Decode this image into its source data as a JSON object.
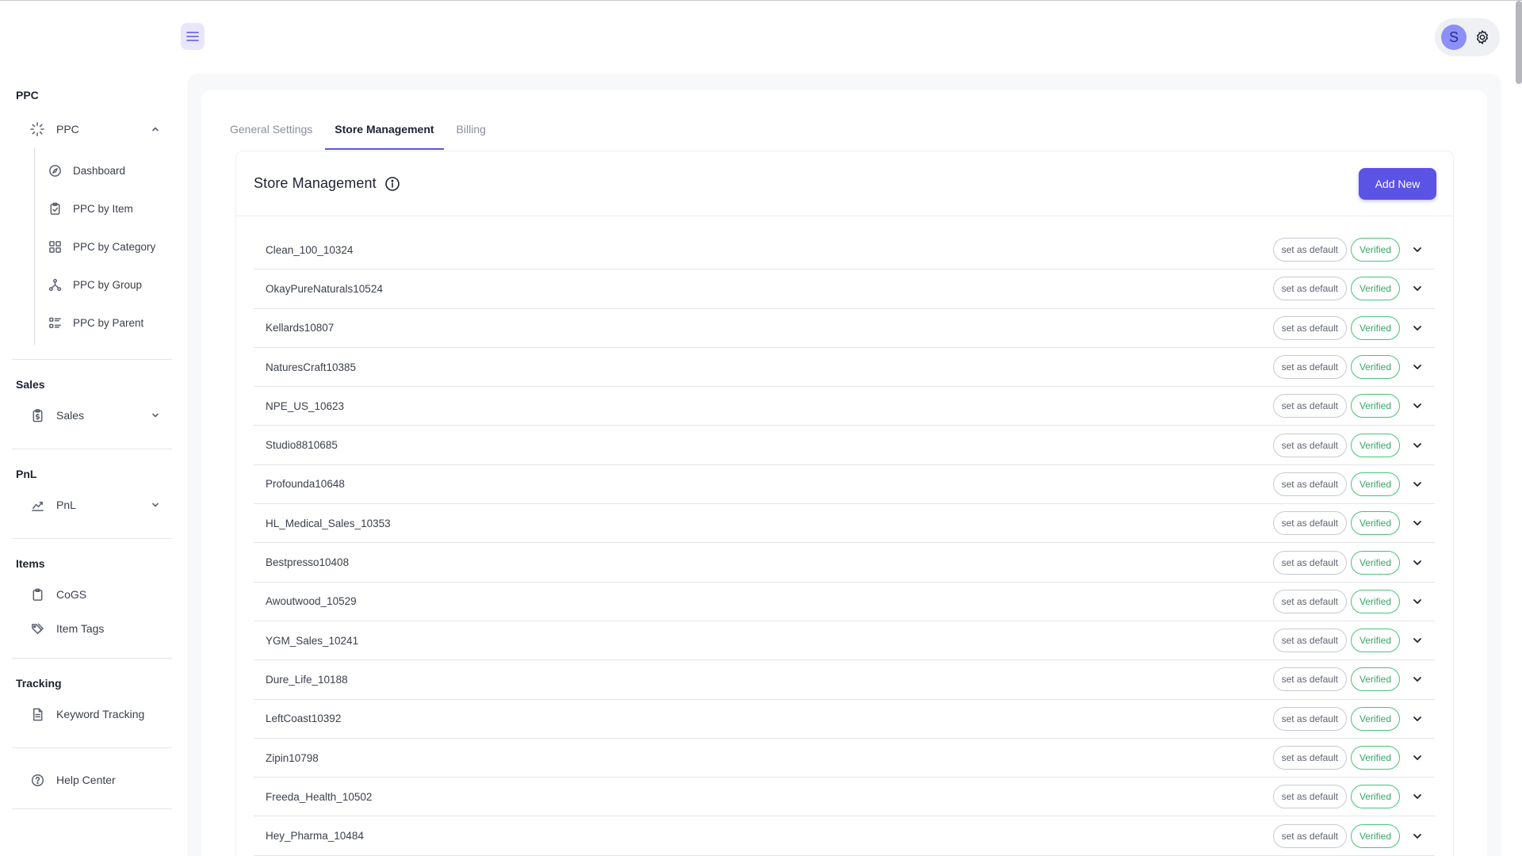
{
  "sidebar": {
    "ppc": {
      "heading": "PPC",
      "group_label": "PPC",
      "items": [
        {
          "label": "Dashboard",
          "icon": "compass-icon"
        },
        {
          "label": "PPC by Item",
          "icon": "clipboard-icon"
        },
        {
          "label": "PPC by Category",
          "icon": "grid-icon"
        },
        {
          "label": "PPC by Group",
          "icon": "network-icon"
        },
        {
          "label": "PPC by Parent",
          "icon": "list-icon"
        }
      ]
    },
    "sales": {
      "heading": "Sales",
      "group_label": "Sales"
    },
    "pnl": {
      "heading": "PnL",
      "group_label": "PnL"
    },
    "items": {
      "heading": "Items",
      "cogs": "CoGS",
      "tags": "Item Tags"
    },
    "tracking": {
      "heading": "Tracking",
      "keyword": "Keyword Tracking"
    },
    "help": "Help Center"
  },
  "header": {
    "avatar_initial": "S"
  },
  "tabs": [
    {
      "label": "General Settings",
      "active": false
    },
    {
      "label": "Store Management",
      "active": true
    },
    {
      "label": "Billing",
      "active": false
    }
  ],
  "card": {
    "title": "Store Management",
    "add_label": "Add New",
    "default_label": "set as default",
    "verified_label": "Verified"
  },
  "stores": [
    "Clean_100_10324",
    "OkayPureNaturals10524",
    "Kellards10807",
    "NaturesCraft10385",
    "NPE_US_10623",
    "Studio8810685",
    "Profounda10648",
    "HL_Medical_Sales_10353",
    "Bestpresso10408",
    "Awoutwood_10529",
    "YGM_Sales_10241",
    "Dure_Life_10188",
    "LeftCoast10392",
    "Zipin10798",
    "Freeda_Health_10502",
    "Hey_Pharma_10484"
  ],
  "colors": {
    "accent": "#5b52e6",
    "verified": "#34a866",
    "avatar_bg": "#8b8ff6"
  }
}
